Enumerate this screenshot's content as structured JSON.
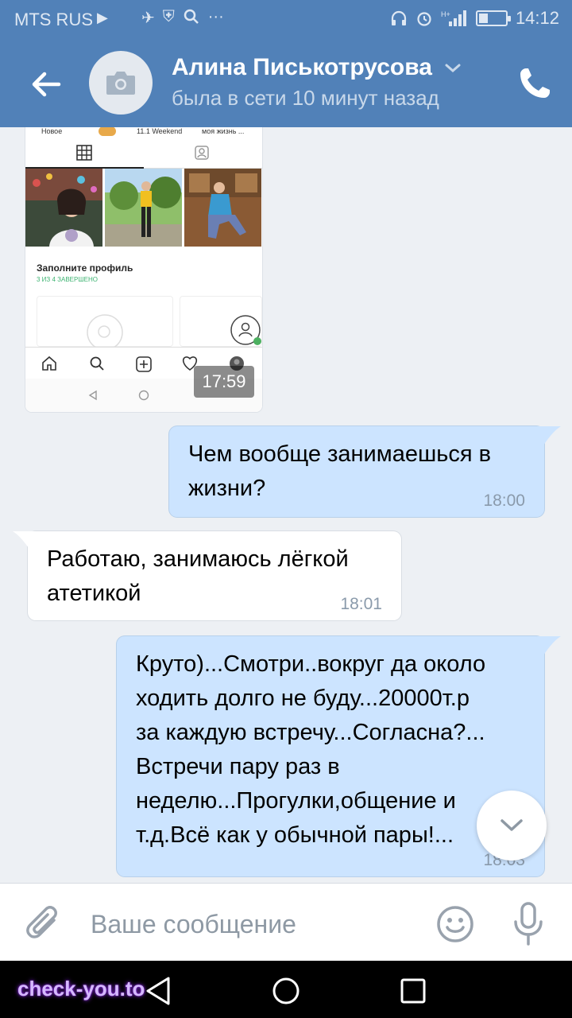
{
  "status_bar": {
    "carrier": "MTS RUS",
    "time": "14:12",
    "battery_level": 0.35
  },
  "header": {
    "contact_name": "Алина Писькотрусова",
    "last_seen": "была в сети 10 минут назад"
  },
  "photo_message": {
    "time": "17:59",
    "inner_stories": [
      "Новое",
      "11.1 Weekend",
      "моя жизнь ..."
    ],
    "inner_fill_title": "Заполните профиль",
    "inner_fill_sub": "3 ИЗ 4 ЗАВЕРШЕНО"
  },
  "messages": [
    {
      "direction": "out",
      "text": "Чем вообще занимаешься в\nжизни?",
      "time": "18:00"
    },
    {
      "direction": "in",
      "text": "Работаю, занимаюсь лёгкой\nатетикой",
      "time": "18:01"
    },
    {
      "direction": "out",
      "text": "Круто)...Смотри..вокруг да около\nходить долго не буду...20000т.р\nза каждую встречу...Согласна?...\nВстречи пару раз в\nнеделю...Прогулки,общение и\nт.д.Всё как у обычной пары!...",
      "time": "18:03"
    }
  ],
  "composer": {
    "placeholder": "Ваше сообщение"
  },
  "watermark": "check-you.to",
  "colors": {
    "header_bg": "#5181b8",
    "outgoing_bubble": "#cce4ff",
    "incoming_bubble": "#ffffff",
    "chat_bg": "#edf0f4"
  },
  "icons": [
    "back-arrow-icon",
    "camera-icon",
    "chevron-down-icon",
    "phone-icon",
    "paperclip-icon",
    "smile-icon",
    "microphone-icon",
    "scroll-down-icon"
  ]
}
